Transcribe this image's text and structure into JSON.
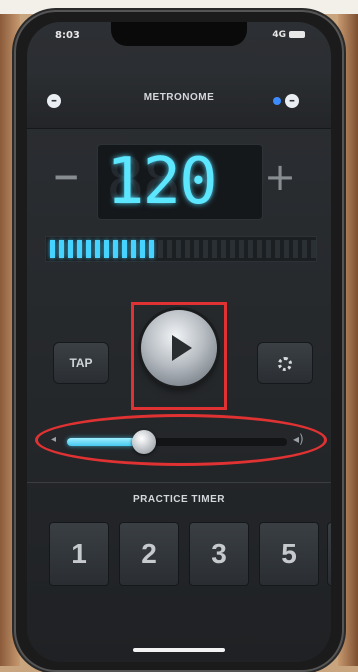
{
  "status": {
    "time": "8:03",
    "network": "4G"
  },
  "header": {
    "title": "METRONOME"
  },
  "tempo": {
    "bpm": "120",
    "ghost": "888",
    "minus_label": "−",
    "plus_label": "+"
  },
  "beat_bar": {
    "total": 30,
    "active": 12,
    "accent_color": "#46d3ff"
  },
  "controls": {
    "tap_label": "TAP",
    "play_icon": "play-icon",
    "settings_icon": "gear-icon"
  },
  "volume": {
    "level": 0.35,
    "low_icon": "◂",
    "high_icon": "◂)"
  },
  "practice_timer": {
    "title": "PRACTICE TIMER",
    "options": [
      "1",
      "2",
      "3",
      "5"
    ]
  },
  "annotations": {
    "highlight_color": "#e03232"
  }
}
